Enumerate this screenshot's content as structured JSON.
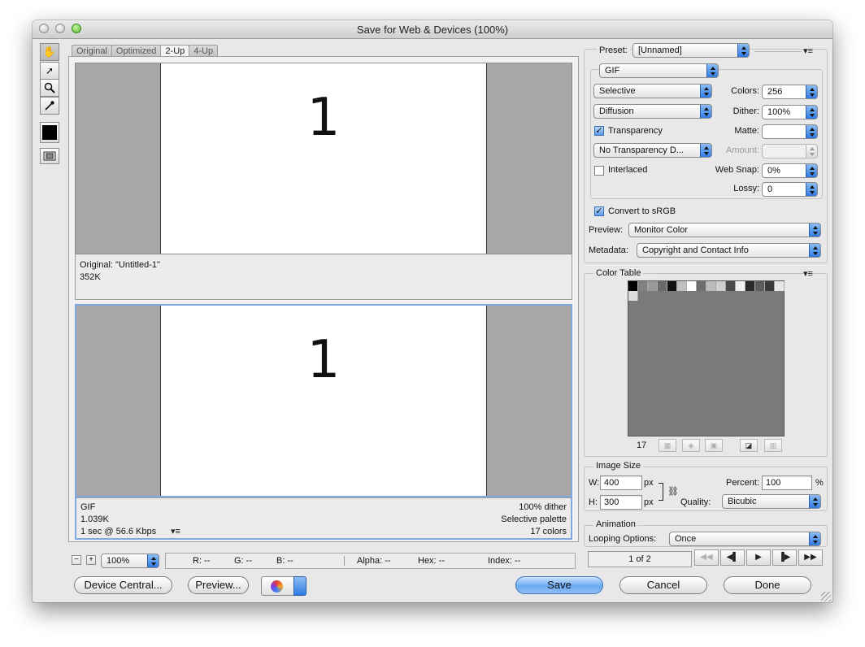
{
  "window": {
    "title": "Save for Web & Devices (100%)"
  },
  "tabs": [
    "Original",
    "Optimized",
    "2-Up",
    "4-Up"
  ],
  "preview": {
    "glyph": "1",
    "original": {
      "line1": "Original: \"Untitled-1\"",
      "line2": "352K"
    },
    "optimized": {
      "left": [
        "GIF",
        "1.039K",
        "1 sec @ 56.6 Kbps"
      ],
      "right": [
        "100% dither",
        "Selective palette",
        "17 colors"
      ],
      "menu_glyph": "▾≡"
    }
  },
  "statusbar": {
    "zoom_minus": "−",
    "zoom_plus": "+",
    "zoom": "100%",
    "r": "R: --",
    "g": "G: --",
    "b": "B: --",
    "alpha": "Alpha: --",
    "hex": "Hex: --",
    "index": "Index: --"
  },
  "bottom": {
    "device_central": "Device Central...",
    "preview": "Preview...",
    "save": "Save",
    "cancel": "Cancel",
    "done": "Done"
  },
  "settings": {
    "preset_label": "Preset:",
    "preset_value": "[Unnamed]",
    "menu_glyph": "▾≡",
    "format": "GIF",
    "reduction": "Selective",
    "colors_label": "Colors:",
    "colors_value": "256",
    "dither_algo": "Diffusion",
    "dither_label": "Dither:",
    "dither_value": "100%",
    "transparency_label": "Transparency",
    "transparency_checked": true,
    "matte_label": "Matte:",
    "matte_value": "",
    "transparency_dither": "No Transparency D...",
    "amount_label": "Amount:",
    "amount_value": "",
    "interlaced_label": "Interlaced",
    "interlaced_checked": false,
    "websnap_label": "Web Snap:",
    "websnap_value": "0%",
    "lossy_label": "Lossy:",
    "lossy_value": "0",
    "srgb_label": "Convert to sRGB",
    "srgb_checked": true,
    "preview_label": "Preview:",
    "preview_value": "Monitor Color",
    "metadata_label": "Metadata:",
    "metadata_value": "Copyright and Contact Info",
    "check_glyph": "✓"
  },
  "color_table": {
    "title": "Color Table",
    "count": "17",
    "swatches": [
      "#000000",
      "#808080",
      "#9a9a9a",
      "#6a6a6a",
      "#111111",
      "#c0c0c0",
      "#ffffff",
      "#6e6e6e",
      "#bcbcbc",
      "#cfcfcf",
      "#4a4a4a",
      "#f0f0f0",
      "#2a2a2a",
      "#5c5c5c",
      "#3a3a3a",
      "#e6e6e6",
      "#dddddd"
    ],
    "background": "#7a7a7a"
  },
  "image_size": {
    "title": "Image Size",
    "w_label": "W:",
    "w_value": "400",
    "w_unit": "px",
    "h_label": "H:",
    "h_value": "300",
    "h_unit": "px",
    "percent_label": "Percent:",
    "percent_value": "100",
    "percent_unit": "%",
    "quality_label": "Quality:",
    "quality_value": "Bicubic"
  },
  "animation": {
    "title": "Animation",
    "looping_label": "Looping Options:",
    "looping_value": "Once",
    "frame_counter": "1 of 2"
  }
}
